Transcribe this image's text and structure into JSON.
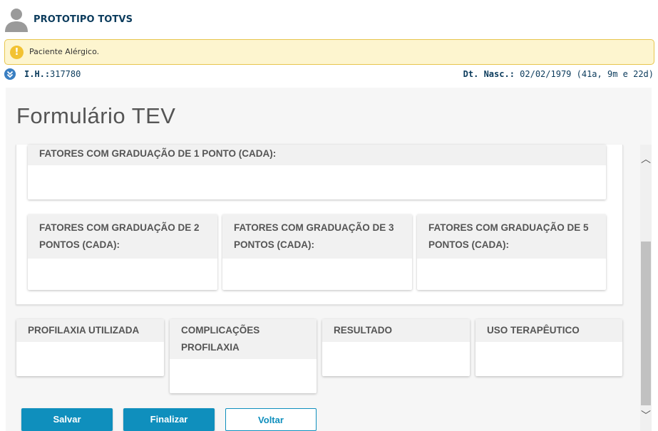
{
  "patient": {
    "name": "PROTOTIPO TOTVS",
    "alert": "Paciente Alérgico.",
    "ih_label": "I.H.:",
    "ih_value": "317780",
    "dob_label": "Dt. Nasc.:",
    "dob_value": "02/02/1979 (41a, 9m e 22d)"
  },
  "icons": {
    "avatar": "user-avatar-icon",
    "alert": "exclamation-icon",
    "expand": "chevron-double-down-icon",
    "scroll_up": "chevron-up-icon",
    "scroll_down": "chevron-down-icon"
  },
  "colors": {
    "primary": "#0f8fbd",
    "alert_bg": "#fdf5cf",
    "alert_border": "#e7c64e",
    "alert_icon": "#f2c232",
    "title_text": "#0b3b5c"
  },
  "page": {
    "title": "Formulário TEV"
  },
  "cards_group": [
    {
      "title": "FATORES COM GRADUAÇÃO DE 1 PONTO (CADA):"
    },
    {
      "title": "FATORES COM GRADUAÇÃO DE 2 PONTOS (CADA):"
    },
    {
      "title": "FATORES COM GRADUAÇÃO DE 3 PONTOS (CADA):"
    },
    {
      "title": "FATORES COM GRADUAÇÃO DE 5 PONTOS (CADA):"
    }
  ],
  "cards_bottom": [
    {
      "title": "PROFILAXIA UTILIZADA"
    },
    {
      "title": "COMPLICAÇÕES PROFILAXIA"
    },
    {
      "title": "RESULTADO"
    },
    {
      "title": "USO TERAPÊUTICO"
    }
  ],
  "buttons": {
    "save": "Salvar",
    "finish": "Finalizar",
    "back": "Voltar"
  },
  "scrollbar": {
    "glyph_up": "︿",
    "glyph_down": "﹀"
  }
}
